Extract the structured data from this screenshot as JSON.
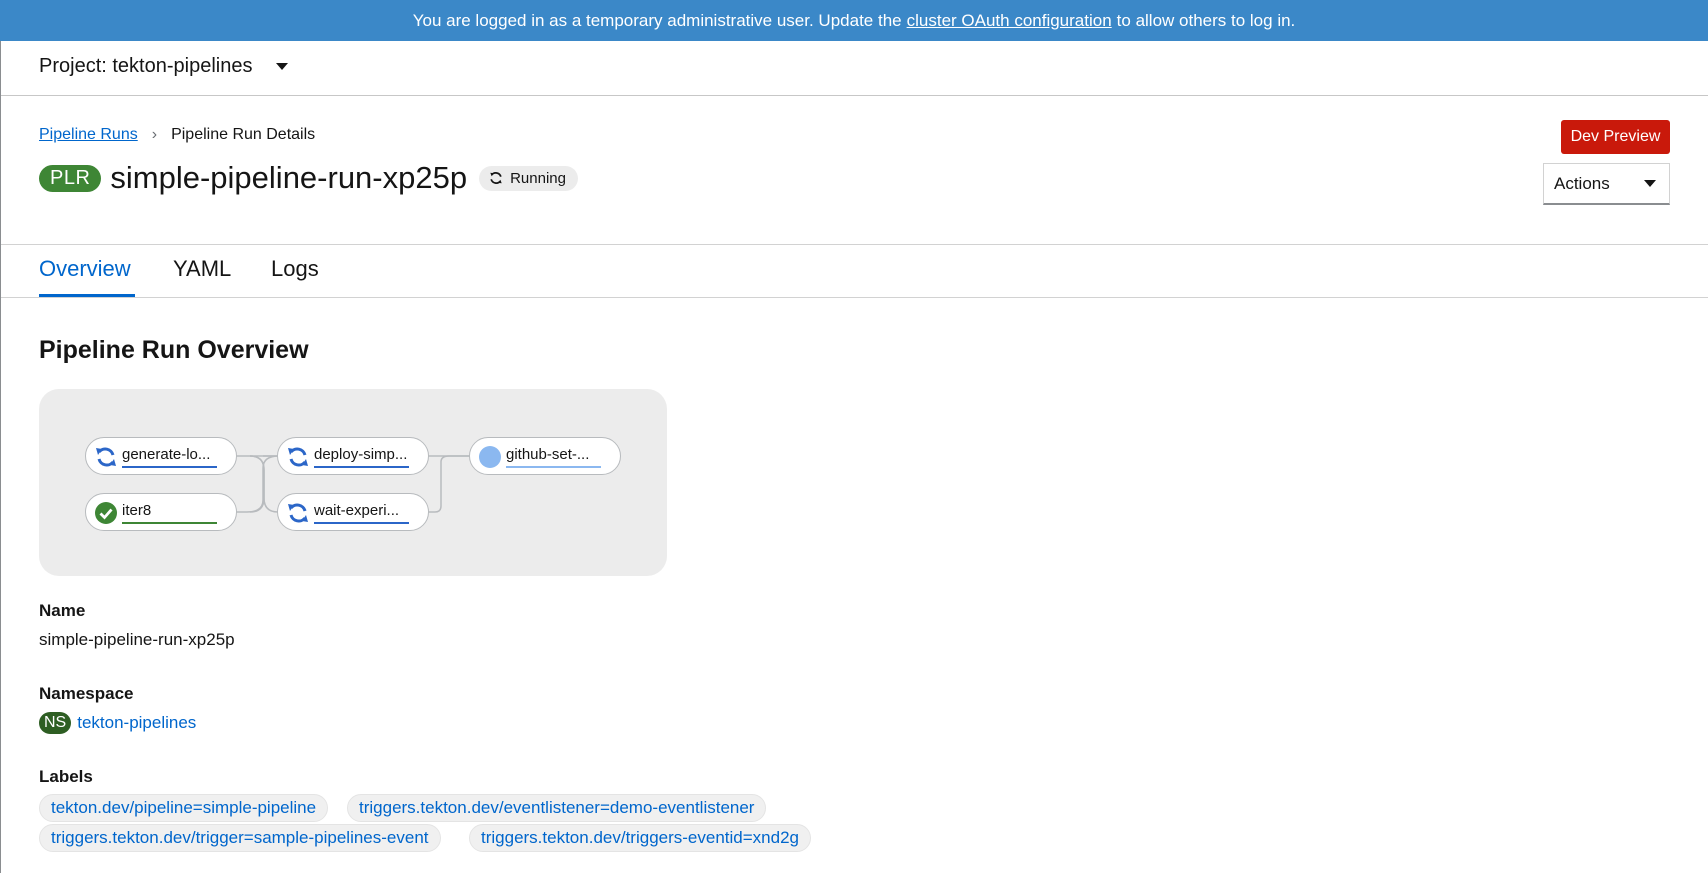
{
  "banner": {
    "prefix": "You are logged in as a temporary administrative user. Update the",
    "link": "cluster OAuth configuration",
    "suffix": "to allow others to log in."
  },
  "project": {
    "label": "Project: tekton-pipelines"
  },
  "breadcrumb": {
    "parent": "Pipeline Runs",
    "current": "Pipeline Run Details"
  },
  "header": {
    "badge": "PLR",
    "title": "simple-pipeline-run-xp25p",
    "status": "Running",
    "dev_preview": "Dev Preview",
    "actions": "Actions"
  },
  "tabs": [
    {
      "label": "Overview",
      "active": true
    },
    {
      "label": "YAML",
      "active": false
    },
    {
      "label": "Logs",
      "active": false
    }
  ],
  "overview": {
    "title": "Pipeline Run Overview",
    "tasks": [
      {
        "label": "generate-lo...",
        "status": "running"
      },
      {
        "label": "iter8",
        "status": "succeeded"
      },
      {
        "label": "deploy-simp...",
        "status": "running"
      },
      {
        "label": "wait-experi...",
        "status": "running"
      },
      {
        "label": "github-set-...",
        "status": "pending"
      }
    ]
  },
  "details": {
    "name_label": "Name",
    "name_value": "simple-pipeline-run-xp25p",
    "namespace_label": "Namespace",
    "namespace_badge": "NS",
    "namespace_value": "tekton-pipelines",
    "labels_label": "Labels",
    "labels": [
      "tekton.dev/pipeline=simple-pipeline",
      "triggers.tekton.dev/eventlistener=demo-eventlistener",
      "triggers.tekton.dev/trigger=sample-pipelines-event",
      "triggers.tekton.dev/triggers-eventid=xnd2g"
    ]
  },
  "colors": {
    "banner": "#3b88c8",
    "link": "#0066cc",
    "running": "#2b66c8",
    "succeeded": "#3e8635",
    "pending": "#8bb8f0",
    "danger_button": "#c9190b"
  }
}
